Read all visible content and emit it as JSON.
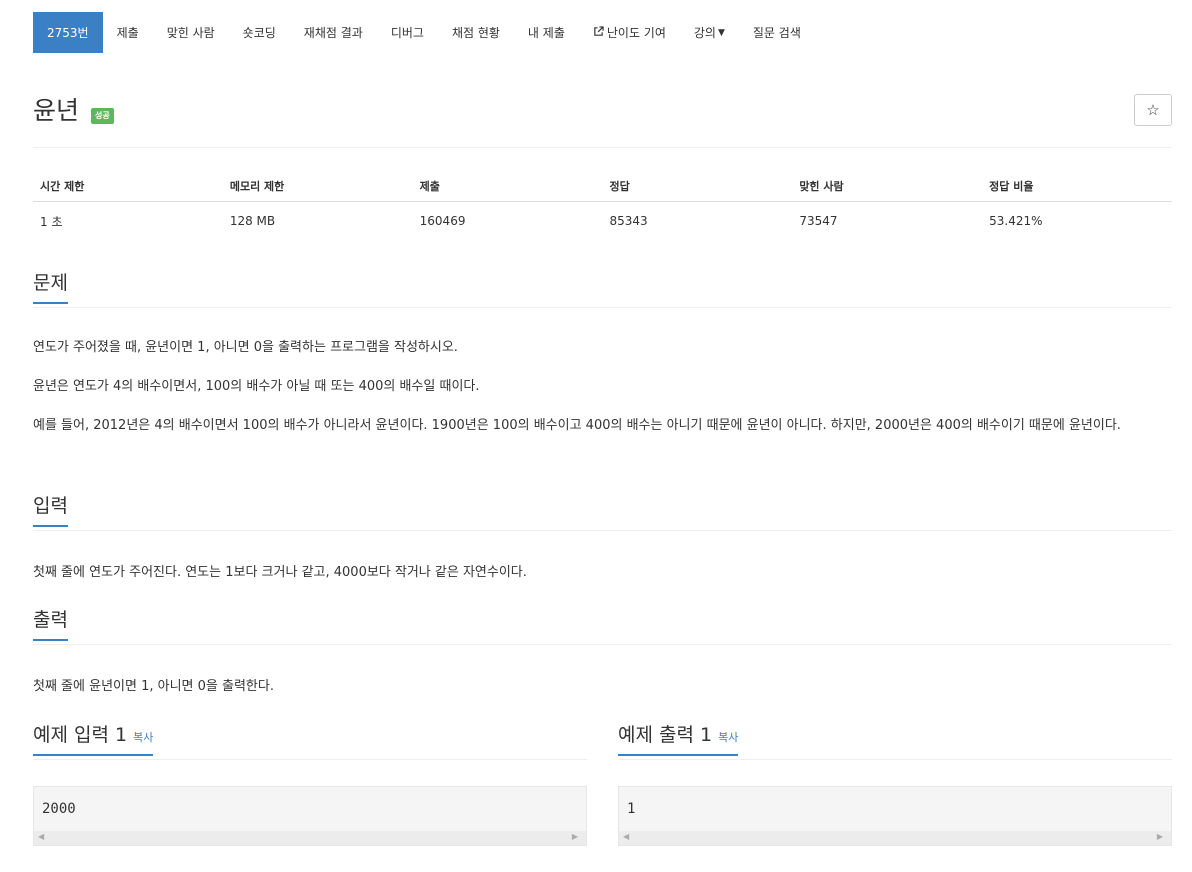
{
  "nav": {
    "tabs": [
      {
        "label": "2753번",
        "active": true
      },
      {
        "label": "제출"
      },
      {
        "label": "맞힌 사람"
      },
      {
        "label": "숏코딩"
      },
      {
        "label": "재채점 결과"
      },
      {
        "label": "디버그"
      },
      {
        "label": "채점 현황"
      },
      {
        "label": "내 제출"
      },
      {
        "label": "난이도 기여",
        "icon": "external-link-icon"
      },
      {
        "label": "강의",
        "icon": "caret-down-icon"
      },
      {
        "label": "질문 검색"
      }
    ]
  },
  "problem": {
    "title": "윤년",
    "badge": "성공",
    "star_icon": "☆"
  },
  "info_table": {
    "headers": [
      "시간 제한",
      "메모리 제한",
      "제출",
      "정답",
      "맞힌 사람",
      "정답 비율"
    ],
    "values": [
      "1 초",
      "128 MB",
      "160469",
      "85343",
      "73547",
      "53.421%"
    ]
  },
  "sections": {
    "problem": {
      "heading": "문제",
      "paragraphs": [
        "연도가 주어졌을 때, 윤년이면 1, 아니면 0을 출력하는 프로그램을 작성하시오.",
        "윤년은 연도가 4의 배수이면서, 100의 배수가 아닐 때 또는 400의 배수일 때이다.",
        "예를 들어, 2012년은 4의 배수이면서 100의 배수가 아니라서 윤년이다. 1900년은 100의 배수이고 400의 배수는 아니기 때문에 윤년이 아니다. 하지만, 2000년은 400의 배수이기 때문에 윤년이다."
      ]
    },
    "input": {
      "heading": "입력",
      "text": "첫째 줄에 연도가 주어진다. 연도는 1보다 크거나 같고, 4000보다 작거나 같은 자연수이다."
    },
    "output": {
      "heading": "출력",
      "text": "첫째 줄에 윤년이면 1, 아니면 0을 출력한다."
    },
    "sample_input": {
      "heading": "예제 입력 1",
      "copy_label": "복사",
      "content": "2000"
    },
    "sample_output": {
      "heading": "예제 출력 1",
      "copy_label": "복사",
      "content": "1"
    }
  },
  "colors": {
    "accent": "#3b7fc4",
    "success": "#5cb85c"
  }
}
